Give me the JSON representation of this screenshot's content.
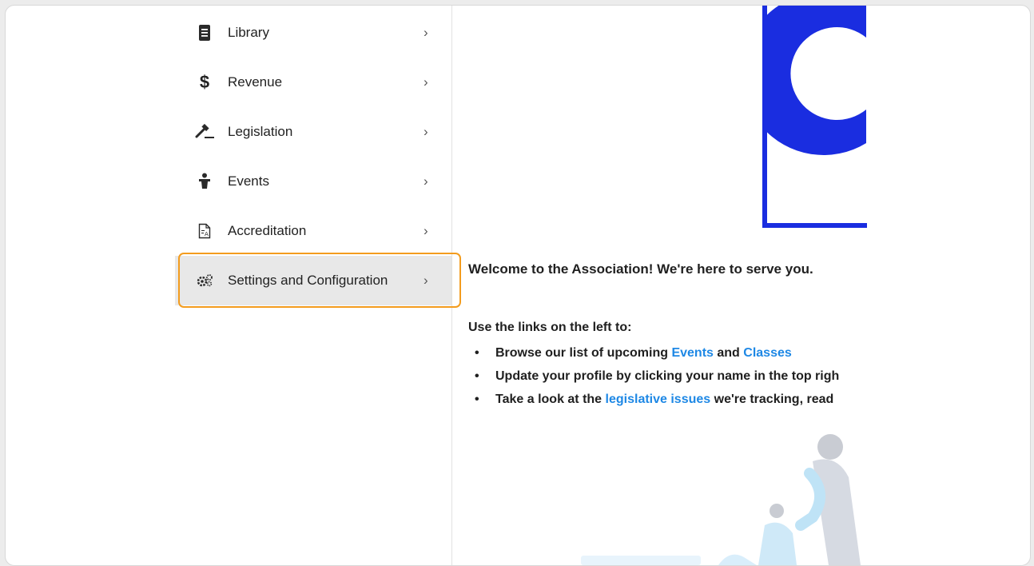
{
  "sidebar": {
    "items": [
      {
        "label": "Library",
        "icon": "book-icon"
      },
      {
        "label": "Revenue",
        "icon": "dollar-icon"
      },
      {
        "label": "Legislation",
        "icon": "gavel-icon"
      },
      {
        "label": "Events",
        "icon": "person-podium-icon"
      },
      {
        "label": "Accreditation",
        "icon": "document-a-icon"
      },
      {
        "label": "Settings and Configuration",
        "icon": "gears-icon",
        "selected": true
      }
    ],
    "chevron": "›"
  },
  "main": {
    "welcome": "Welcome to the Association!  We're here to serve you.",
    "intro": "Use the links on the left to:",
    "bullets": [
      {
        "before": "Browse our list of upcoming ",
        "link1": "Events",
        "middle": " and ",
        "link2": "Classes"
      },
      {
        "text": "Update your profile by clicking your name in the top righ"
      },
      {
        "before": "Take a look at the ",
        "link": "legislative issues",
        "after": " we're tracking, read"
      }
    ]
  },
  "colors": {
    "accent_outline": "#f39c1e",
    "link": "#1e88e5",
    "logo_blue": "#1a2de0"
  }
}
